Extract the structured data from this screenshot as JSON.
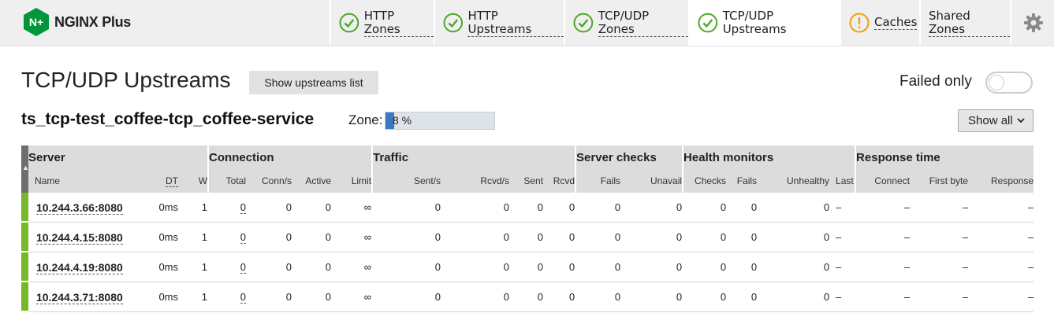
{
  "brand": {
    "name": "NGINX Plus",
    "logo_mark": "N+",
    "color": "#009639"
  },
  "tabs": [
    {
      "label": "HTTP Zones",
      "status": "ok"
    },
    {
      "label": "HTTP Upstreams",
      "status": "ok"
    },
    {
      "label": "TCP/UDP Zones",
      "status": "ok"
    },
    {
      "label": "TCP/UDP Upstreams",
      "status": "ok",
      "active": true
    },
    {
      "label": "Caches",
      "status": "warning"
    },
    {
      "label": "Shared Zones"
    }
  ],
  "settings_icon": "gear-icon",
  "page": {
    "title": "TCP/UDP Upstreams",
    "show_list_label": "Show upstreams list",
    "failed_only_label": "Failed only",
    "failed_only_on": false
  },
  "upstream": {
    "name": "ts_tcp-test_coffee-tcp_coffee-service",
    "zone_label": "Zone:",
    "zone_text": "8 %",
    "zone_usage_percent": 8,
    "show_all_label": "Show all"
  },
  "table": {
    "groups": [
      "Server",
      "Connection",
      "Traffic",
      "Server checks",
      "Health monitors",
      "Response time"
    ],
    "columns": [
      "Name",
      "DT",
      "W",
      "Total",
      "Conn/s",
      "Active",
      "Limit",
      "Sent/s",
      "Rcvd/s",
      "Sent",
      "Rcvd",
      "Fails",
      "Unavail",
      "Checks",
      "Fails",
      "Unhealthy",
      "Last",
      "Connect",
      "First byte",
      "Response"
    ],
    "rows": [
      {
        "name": "10.244.3.66:8080",
        "cells": [
          "0ms",
          "1",
          "0",
          "0",
          "0",
          "∞",
          "0",
          "0",
          "0",
          "0",
          "0",
          "0",
          "0",
          "0",
          "0",
          "–",
          "–",
          "–",
          "–"
        ]
      },
      {
        "name": "10.244.4.15:8080",
        "cells": [
          "0ms",
          "1",
          "0",
          "0",
          "0",
          "∞",
          "0",
          "0",
          "0",
          "0",
          "0",
          "0",
          "0",
          "0",
          "0",
          "–",
          "–",
          "–",
          "–"
        ]
      },
      {
        "name": "10.244.4.19:8080",
        "cells": [
          "0ms",
          "1",
          "0",
          "0",
          "0",
          "∞",
          "0",
          "0",
          "0",
          "0",
          "0",
          "0",
          "0",
          "0",
          "0",
          "–",
          "–",
          "–",
          "–"
        ]
      },
      {
        "name": "10.244.3.71:8080",
        "cells": [
          "0ms",
          "1",
          "0",
          "0",
          "0",
          "∞",
          "0",
          "0",
          "0",
          "0",
          "0",
          "0",
          "0",
          "0",
          "0",
          "–",
          "–",
          "–",
          "–"
        ]
      }
    ]
  }
}
